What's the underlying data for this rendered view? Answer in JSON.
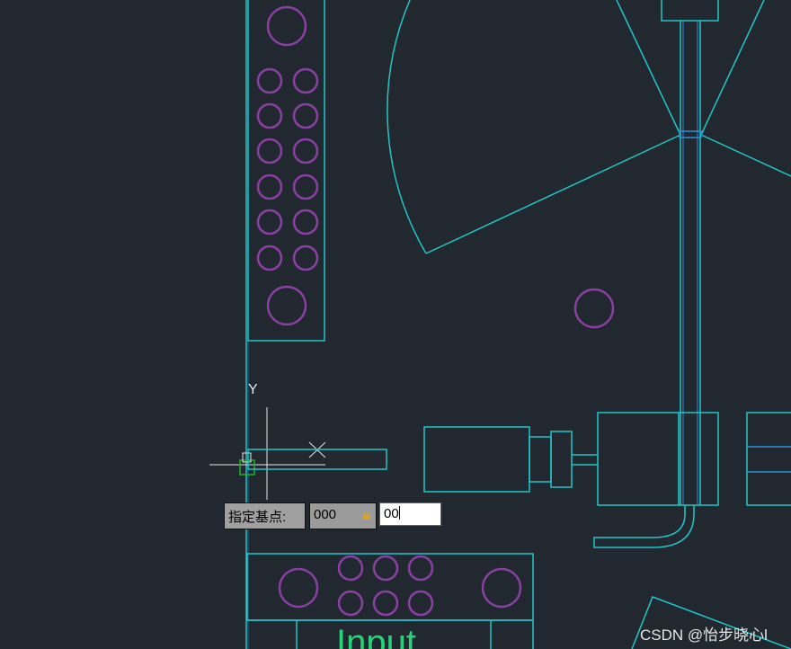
{
  "command_prompt": {
    "label": "指定基点:"
  },
  "coordinate_input": {
    "x_value": "000",
    "y_value": "00"
  },
  "ucs_icon": {
    "y_label": "Y"
  },
  "drawing": {
    "block_label": "Input"
  },
  "watermark": {
    "text": "CSDN @怡步晓心l"
  },
  "colors": {
    "background": "#212830",
    "cyan_line": "#22c6c8",
    "blue_line": "#2a8fd8",
    "purple_circle": "#8a3fa2",
    "green_text": "#27d37a",
    "crosshair": "#e8e8e8",
    "lock_icon": "#e0a020"
  }
}
